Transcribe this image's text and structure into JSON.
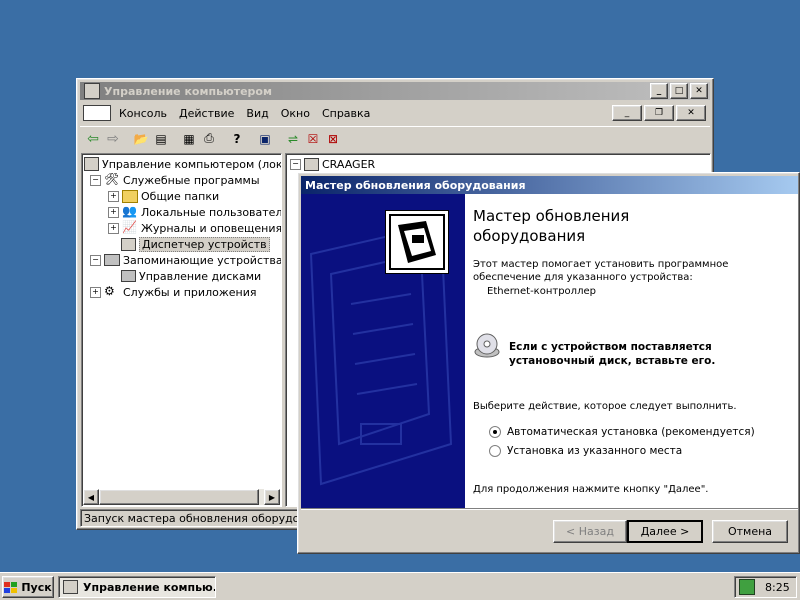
{
  "mmc": {
    "title": "Управление компьютером",
    "menu": [
      "Консоль",
      "Действие",
      "Вид",
      "Окно",
      "Справка"
    ],
    "tree": [
      {
        "label": "Управление компьютером (локаль",
        "expander": ""
      },
      {
        "label": "Служебные программы",
        "expander": "−"
      },
      {
        "label": "Общие папки",
        "expander": "+"
      },
      {
        "label": "Локальные пользователи и",
        "expander": "+"
      },
      {
        "label": "Журналы и оповещения пр",
        "expander": "+"
      },
      {
        "label": "Диспетчер устройств",
        "expander": ""
      },
      {
        "label": "Запоминающие устройства",
        "expander": "−"
      },
      {
        "label": "Управление дисками",
        "expander": ""
      },
      {
        "label": "Службы и приложения",
        "expander": "+"
      }
    ],
    "right_root": "CRAAGER",
    "right_expander": "−",
    "status": "Запуск мастера обновления оборудования"
  },
  "wizard": {
    "title": "Мастер обновления оборудования",
    "heading": "Мастер обновления оборудования",
    "intro": "Этот мастер помогает установить программное обеспечение для указанного устройства:",
    "device": "Ethernet-контроллер",
    "cd_note": "Если с устройством поставляется установочный диск, вставьте его.",
    "prompt": "Выберите действие, которое следует выполнить.",
    "options": [
      {
        "label": "Автоматическая установка (рекомендуется)",
        "selected": true
      },
      {
        "label": "Установка из указанного места",
        "selected": false
      }
    ],
    "continue_note": "Для продолжения нажмите кнопку \"Далее\".",
    "back": "< Назад",
    "next": "Далее >",
    "cancel": "Отмена"
  },
  "taskbar": {
    "start": "Пуск",
    "task": "Управление компью...",
    "clock": "8:25"
  },
  "colors": {
    "desktop": "#3a6ea5",
    "wizard_banner": "#0a1080",
    "title_active": "#0a246a"
  }
}
